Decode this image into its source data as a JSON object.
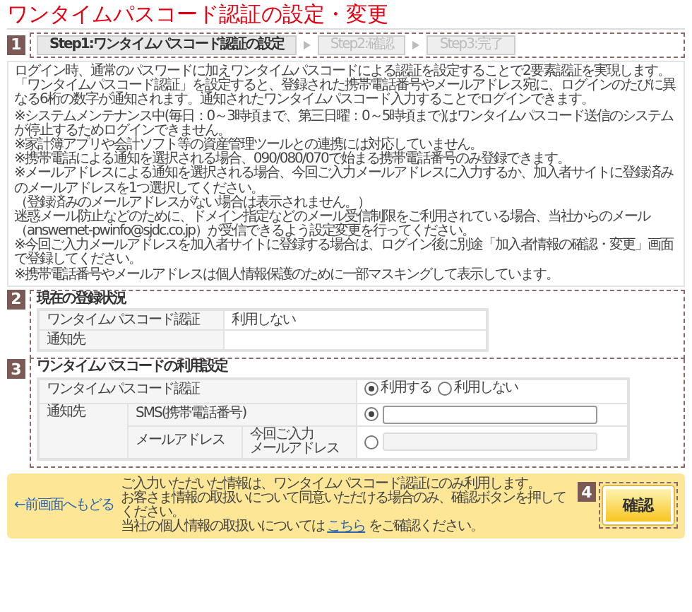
{
  "title": "ワンタイムパスコード認証の設定・変更",
  "steps": {
    "badge": "1",
    "items": [
      {
        "label": "Step1:ワンタイムパスコード認証の設定",
        "selected": true
      },
      {
        "label": "Step2:確認",
        "selected": false
      },
      {
        "label": "Step3:完了",
        "selected": false
      }
    ]
  },
  "intro": [
    "ログイン時、通常のパスワードに加えワンタイムパスコードによる認証を設定することで2要素認証を実現します。",
    "「ワンタイムパスコード認証」を設定すると、登録された携帯電話番号やメールアドレス宛に、ログインのたびに異なる6桁の数字が通知されます。通知されたワンタイムパスコード入力することでログインできます。"
  ],
  "notes": [
    "※システムメンテナンス中(毎日：0～3時頃まで、第三日曜：0～5時頃まで)はワンタイムパスコード送信のシステムが停止するためログインできません。",
    "※家計簿アプリや会計ソフト等の資産管理ツールとの連携には対応していません。",
    "※携帯電話による通知を選択される場合、090/080/070で始まる携帯電話番号のみ登録できます。",
    "※メールアドレスによる通知を選択される場合、今回ご入力メールアドレスに入力するか、加入者サイトに登録済みのメールアドレスを1つ選択してください。",
    "（登録済みのメールアドレスがない場合は表示されません。）",
    "迷惑メール防止などのために、ドメイン指定などのメール受信制限をご利用されている場合、当社からのメール（answernet-pwinfo@sjdc.co.jp）が受信できるよう設定変更を行ってください。",
    "※今回ご入力メールアドレスを加入者サイトに登録する場合は、ログイン後に別途「加入者情報の確認・変更」画面で登録してください。",
    "※携帯電話番号やメールアドレスは個人情報保護のために一部マスキングして表示しています。"
  ],
  "current_status": {
    "badge": "2",
    "heading": "現在の登録状況",
    "rows": [
      {
        "label": "ワンタイムパスコード認証",
        "value": "利用しない"
      },
      {
        "label": "通知先"
      }
    ]
  },
  "usage_settings": {
    "badge": "3",
    "heading": "ワンタイムパスコードの利用設定",
    "auth_label": "ワンタイムパスコード認証",
    "options": [
      {
        "label": "利用する",
        "selected": true
      },
      {
        "label": "利用しない",
        "selected": false
      }
    ],
    "destination_label": "通知先",
    "destinations": [
      {
        "kind": "sms",
        "label": "SMS(携帯電話番号)",
        "selected": true,
        "disabled": false
      },
      {
        "kind": "mail",
        "label": "メールアドレス",
        "sublabel": [
          "今回ご入力",
          "メールアドレス"
        ],
        "selected": false,
        "disabled": true
      }
    ]
  },
  "footer": {
    "back_link": "←前画面へもどる",
    "notice": [
      "ご入力いただいた情報は、ワンタイムパスコード認証にのみ利用します。",
      "お客さま情報の取扱いについて同意いただける場合のみ、確認ボタンを押してください。"
    ],
    "privacy": {
      "before": "当社の個人情報の取扱いについては ",
      "link": "こちら",
      "after": " をご確認ください。"
    },
    "confirm_badge": "4",
    "confirm_button": "確認"
  }
}
